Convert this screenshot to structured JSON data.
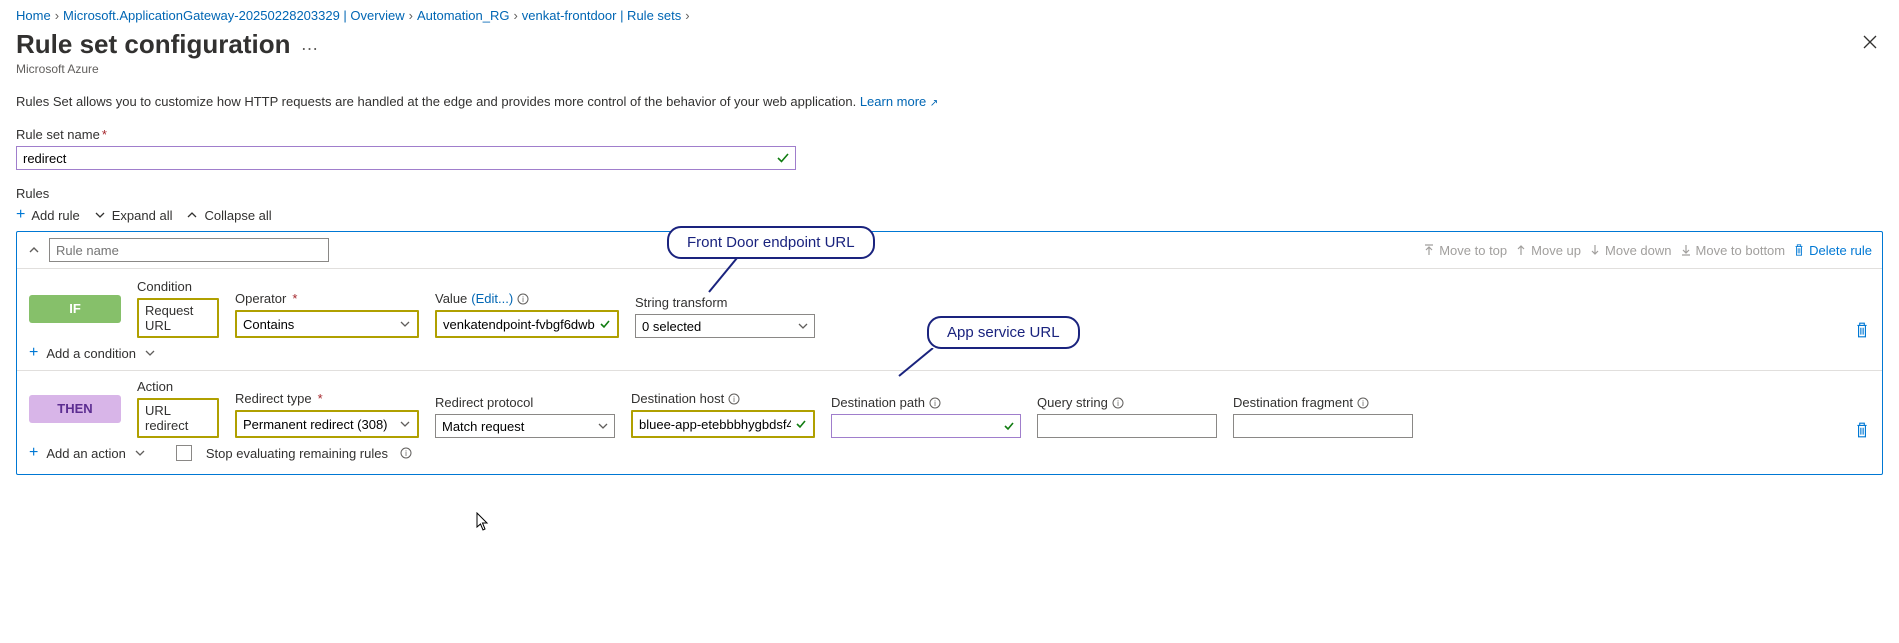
{
  "breadcrumb": [
    {
      "label": "Home"
    },
    {
      "label": "Microsoft.ApplicationGateway-20250228203329 | Overview"
    },
    {
      "label": "Automation_RG"
    },
    {
      "label": "venkat-frontdoor | Rule sets"
    }
  ],
  "page": {
    "title": "Rule set configuration",
    "subtitle": "Microsoft Azure",
    "blurb": "Rules Set allows you to customize how HTTP requests are handled at the edge and provides more control of the behavior of your web application.",
    "learn_more": "Learn more"
  },
  "ruleset": {
    "name_label": "Rule set name",
    "name_value": "redirect"
  },
  "rules_section_label": "Rules",
  "toolbar": {
    "add_rule": "Add rule",
    "expand_all": "Expand all",
    "collapse_all": "Collapse all"
  },
  "rule_header": {
    "name_placeholder": "Rule name",
    "move_top": "Move to top",
    "move_up": "Move up",
    "move_down": "Move down",
    "move_bottom": "Move to bottom",
    "delete": "Delete rule"
  },
  "if_row": {
    "chip": "IF",
    "condition_label": "Condition",
    "condition_value": "Request URL",
    "operator_label": "Operator",
    "operator_value": "Contains",
    "value_label": "Value",
    "value_edit": "(Edit...)",
    "value_value": "venkatendpoint-fvbgf6dwb...",
    "string_transform_label": "String transform",
    "string_transform_value": "0 selected",
    "add_condition": "Add a condition"
  },
  "then_row": {
    "chip": "THEN",
    "action_label": "Action",
    "action_value": "URL redirect",
    "redirect_type_label": "Redirect type",
    "redirect_type_value": "Permanent redirect (308)",
    "redirect_proto_label": "Redirect protocol",
    "redirect_proto_value": "Match request",
    "dest_host_label": "Destination host",
    "dest_host_value": "bluee-app-etebbbhygbdsf4...",
    "dest_path_label": "Destination path",
    "dest_path_value": "",
    "query_string_label": "Query string",
    "query_string_value": "",
    "dest_frag_label": "Destination fragment",
    "dest_frag_value": "",
    "add_action": "Add an action",
    "stop_eval": "Stop evaluating remaining rules"
  },
  "callouts": {
    "frontdoor": "Front Door endpoint URL",
    "appservice": "App service URL"
  }
}
